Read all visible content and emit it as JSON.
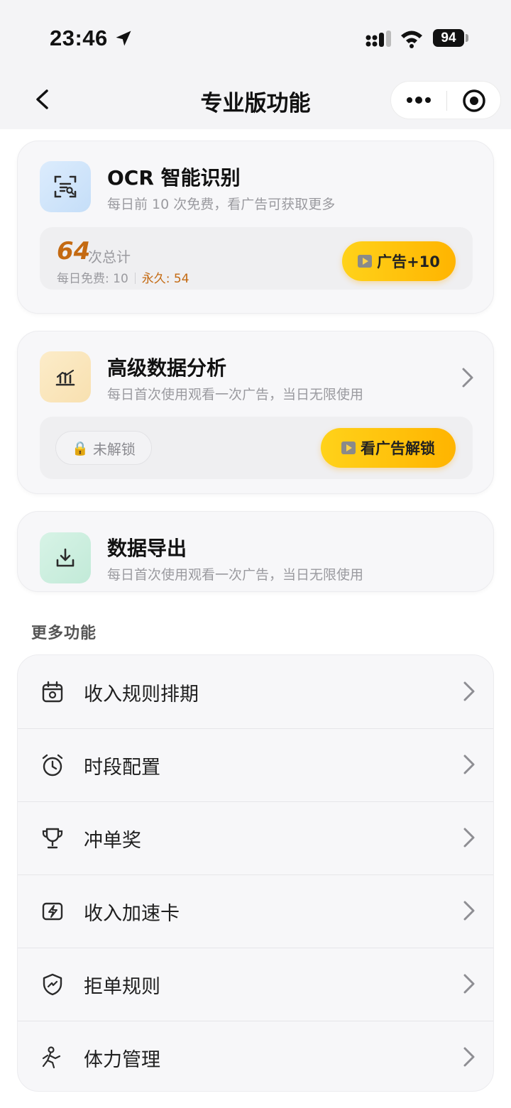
{
  "status_bar": {
    "time": "23:46",
    "battery": "94"
  },
  "nav": {
    "title": "专业版功能"
  },
  "features": [
    {
      "title": "OCR 智能识别",
      "desc": "每日前 10 次免费，看广告可获取更多",
      "icon": "ocr-scan-icon",
      "icon_bg": "#d6e8fb",
      "count": "64",
      "count_label": "次总计",
      "daily_free": "每日免费: 10",
      "permanent": "永久: 54",
      "ad_button": "广告+10"
    },
    {
      "title": "高级数据分析",
      "desc": "每日首次使用观看一次广告，当日无限使用",
      "icon": "chart-icon",
      "icon_bg": "#fbe9c4",
      "lock_label": "未解锁",
      "ad_button": "看广告解锁"
    },
    {
      "title": "数据导出",
      "desc": "每日首次使用观看一次广告，当日无限使用",
      "icon": "download-icon",
      "icon_bg": "#d3f0e3"
    }
  ],
  "more": {
    "title": "更多功能",
    "items": [
      {
        "label": "收入规则排期",
        "icon": "calendar-icon"
      },
      {
        "label": "时段配置",
        "icon": "alarm-clock-icon"
      },
      {
        "label": "冲单奖",
        "icon": "trophy-icon"
      },
      {
        "label": "收入加速卡",
        "icon": "lightning-card-icon"
      },
      {
        "label": "拒单规则",
        "icon": "shield-icon"
      },
      {
        "label": "体力管理",
        "icon": "running-person-icon"
      }
    ]
  },
  "colors": {
    "accent_orange": "#c46a12",
    "ad_button": "#ffc107"
  }
}
